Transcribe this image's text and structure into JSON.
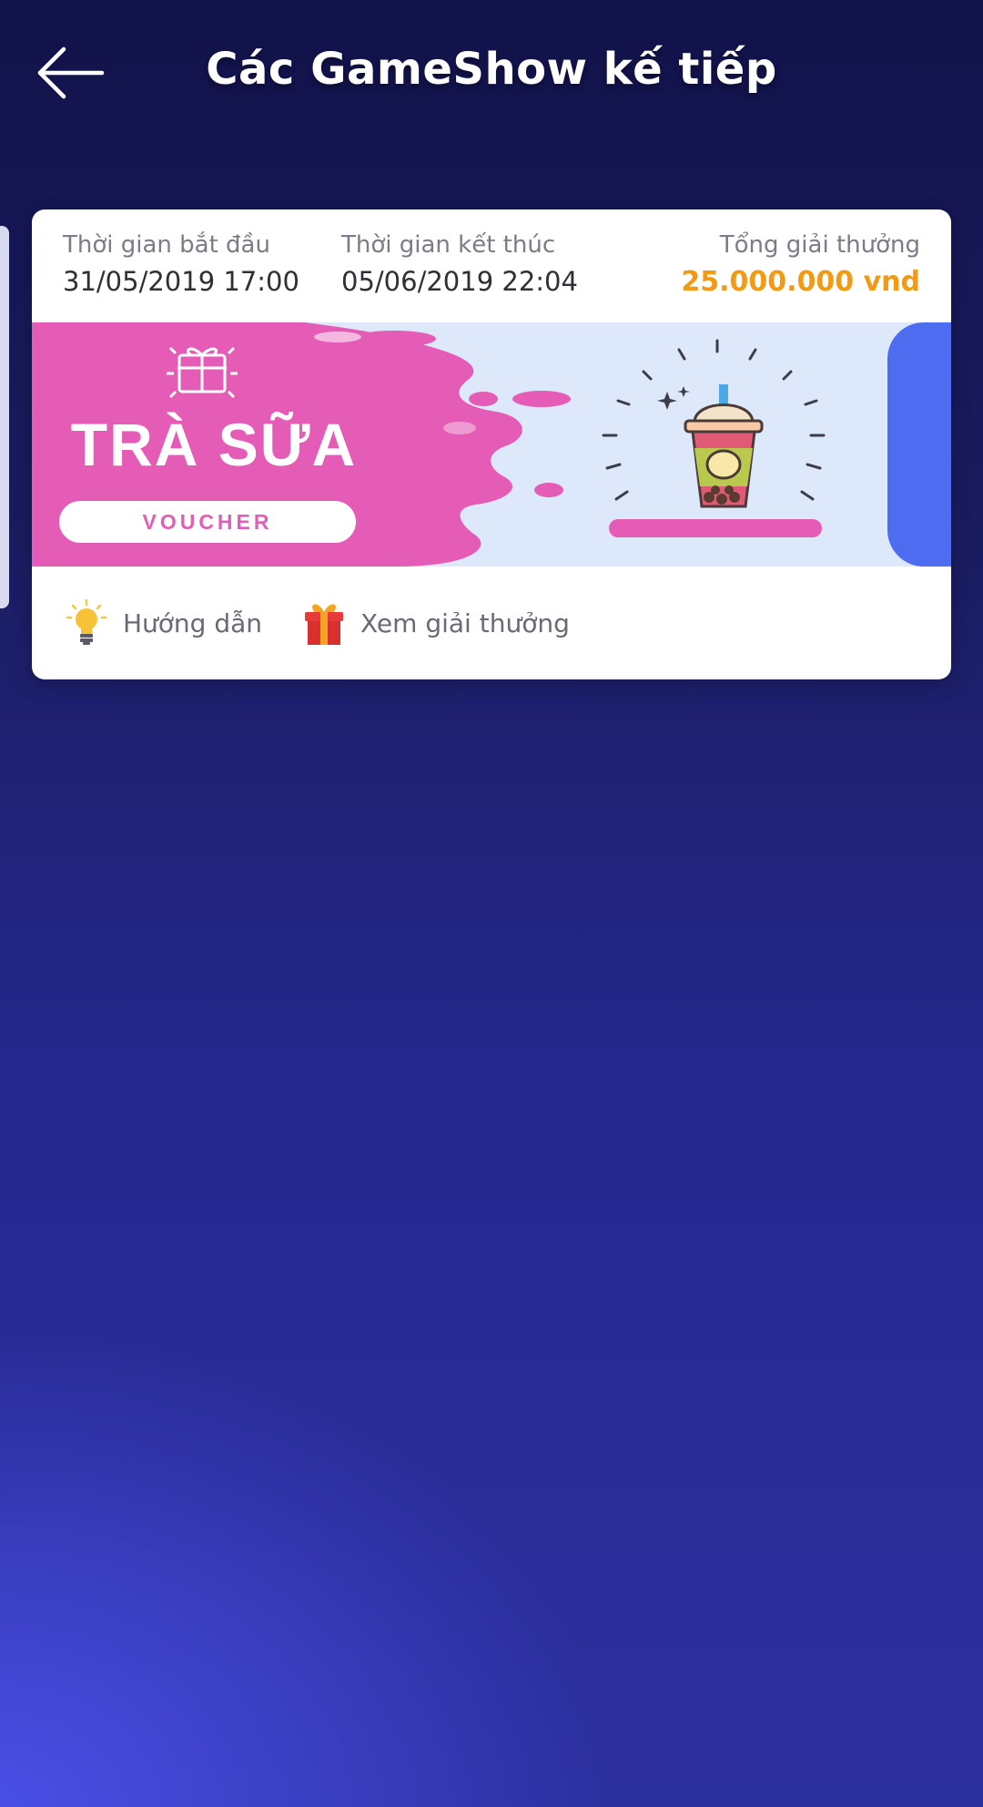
{
  "header": {
    "title": "Các GameShow kế tiếp",
    "back_icon": "arrow-left-icon"
  },
  "gameshow": {
    "start": {
      "label": "Thời gian bắt đầu",
      "value": "31/05/2019 17:00"
    },
    "end": {
      "label": "Thời gian kết thúc",
      "value": "05/06/2019 22:04"
    },
    "prize": {
      "label": "Tổng giải thưởng",
      "value": "25.000.000 vnd"
    },
    "banner": {
      "title": "TRÀ SỮA",
      "tag": "VOUCHER"
    },
    "actions": {
      "guide": "Hướng dẫn",
      "prizes": "Xem giải thưởng"
    }
  },
  "colors": {
    "prize_value": "#f39a12",
    "banner_pink": "#e45cb6",
    "banner_bg": "#dde8fb",
    "next_tab": "#4d6cf0"
  }
}
